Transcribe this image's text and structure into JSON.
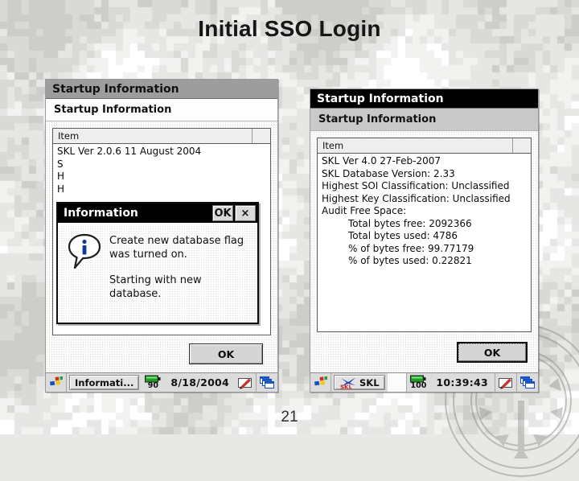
{
  "slide": {
    "title": "Initial SSO Login",
    "page_number": "21"
  },
  "left_window": {
    "titlebar": "Startup Information",
    "subheader": "Startup Information",
    "list": {
      "columns": [
        "Item",
        ""
      ],
      "rows": [
        "SKL Ver 2.0.6   11 August 2004",
        "S",
        "H",
        "H"
      ]
    },
    "ok_button": "OK",
    "dialog": {
      "title": "Information",
      "ok_button": "OK",
      "close_button": "×",
      "icon": "information-icon",
      "paragraphs": [
        "Create new database flag was turned on.",
        "Starting with new database."
      ]
    },
    "taskbar": {
      "start_icon": "windows-start-icon",
      "task_label": "Informati...",
      "task_icon": "",
      "battery_level": "90",
      "battery_icon": "battery-icon",
      "clock": "8/18/2004",
      "pen_icon": "stylus-pen-icon",
      "windows_icon": "cascade-windows-icon"
    }
  },
  "right_window": {
    "titlebar": "Startup Information",
    "subheader": "Startup Information",
    "list": {
      "columns": [
        "Item",
        ""
      ],
      "rows": [
        {
          "text": "SKL Ver 4.0   27-Feb-2007",
          "indent": false
        },
        {
          "text": "SKL Database Version: 2.33",
          "indent": false
        },
        {
          "text": "Highest SOI Classification: Unclassified",
          "indent": false
        },
        {
          "text": "Highest Key Classification: Unclassified",
          "indent": false
        },
        {
          "text": "Audit Free Space:",
          "indent": false
        },
        {
          "text": "Total bytes free: 2092366",
          "indent": true
        },
        {
          "text": "Total bytes used: 4786",
          "indent": true
        },
        {
          "text": "% of bytes free: 99.77179",
          "indent": true
        },
        {
          "text": "% of bytes used: 0.22821",
          "indent": true
        }
      ]
    },
    "ok_button": "OK",
    "taskbar": {
      "start_icon": "windows-start-icon",
      "task_label": "SKL",
      "task_icon": "skl-app-icon",
      "battery_level": "100",
      "battery_icon": "battery-icon",
      "clock": "10:39:43",
      "pen_icon": "stylus-pen-icon",
      "windows_icon": "cascade-windows-icon"
    }
  },
  "background": {
    "pattern": "digital-camouflage",
    "colors": [
      "#ffffff",
      "#ededeb",
      "#dcdcd8",
      "#c9c9c4",
      "#b8b8b2"
    ],
    "watermark": "military-seal-watermark"
  }
}
